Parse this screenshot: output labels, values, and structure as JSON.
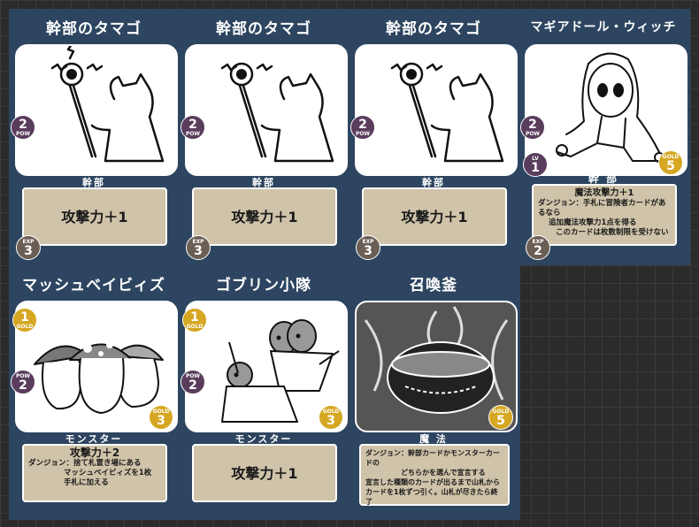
{
  "cards": [
    {
      "title": "幹部のタマゴ",
      "type": "幹部",
      "text": "攻撃力＋1",
      "pow": "2",
      "pow_label": "POW",
      "exp": "3",
      "exp_label": "EXP"
    },
    {
      "title": "幹部のタマゴ",
      "type": "幹部",
      "text": "攻撃力＋1",
      "pow": "2",
      "pow_label": "POW",
      "exp": "3",
      "exp_label": "EXP"
    },
    {
      "title": "幹部のタマゴ",
      "type": "幹部",
      "text": "攻撃力＋1",
      "pow": "2",
      "pow_label": "POW",
      "exp": "3",
      "exp_label": "EXP"
    },
    {
      "title": "マギアドール・ウィッチ",
      "type": "幹 部",
      "text_line1": "魔法攻撃力＋1",
      "text_line2": "ダンジョン：手札に冒険者カードがあるなら",
      "text_line3": "追加魔法攻撃力1点を得る",
      "text_line4": "このカードは枚数制限を受けない",
      "pow": "2",
      "pow_label": "POW",
      "lv": "1",
      "lv_label": "LV",
      "gold": "5",
      "gold_label": "GOLD",
      "exp": "2",
      "exp_label": "EXP"
    },
    {
      "title": "マッシュベイビィズ",
      "type": "モンスター",
      "text_line1": "攻撃力＋2",
      "text_line2": "ダンジョン：捨て札置き場にある",
      "text_line3": "マッシュベイビィズを1枚",
      "text_line4": "手札に加える",
      "gold_top": "1",
      "gold_label": "GOLD",
      "pow": "2",
      "pow_label": "POW",
      "gold": "3"
    },
    {
      "title": "ゴブリン小隊",
      "type": "モンスター",
      "text": "攻撃力＋1",
      "gold_top": "1",
      "gold_label": "GOLD",
      "pow": "2",
      "pow_label": "POW",
      "gold": "3"
    },
    {
      "title": "召喚釜",
      "type": "魔 法",
      "text_line1": "ダンジョン：幹部カードかモンスターカードの",
      "text_line2": "どちらかを選んで宣言する",
      "text_line3": "宣言した種類のカードが出るまで山札から",
      "text_line4": "カードを1枚ずつ引く。山札が尽きたら終了",
      "gold": "5",
      "gold_label": "GOLD"
    }
  ],
  "colors": {
    "sheet": "#2d4560",
    "text_box": "#cfc3a9",
    "pow": "#5a3d5c",
    "gold": "#d6a722",
    "exp": "#6b5f55"
  }
}
